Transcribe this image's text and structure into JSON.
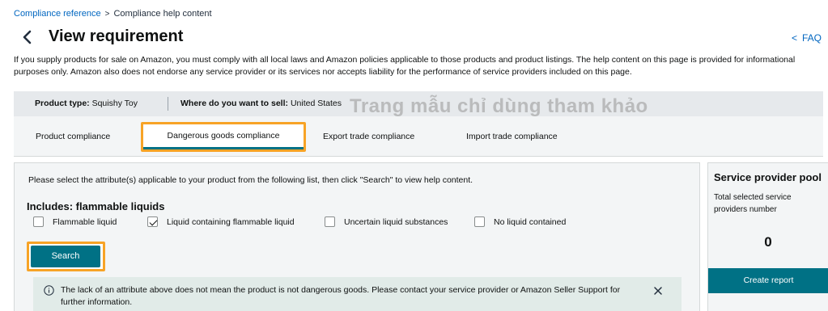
{
  "breadcrumb": {
    "root_label": "Compliance reference",
    "separator": ">",
    "current_label": "Compliance help content"
  },
  "header": {
    "title": "View requirement",
    "faq_label": "FAQ",
    "faq_chevron": "<"
  },
  "disclaimer": "If you supply products for sale on Amazon, you must comply with all local laws and Amazon policies applicable to those products and product listings. The help content on this page is provided for informational purposes only. Amazon also does not endorse any service provider or its services nor accepts liability for the performance of service providers included on this page.",
  "product_bar": {
    "product_type_label": "Product type:",
    "product_type_value": "Squishy Toy",
    "sell_where_label": "Where do you want to sell:",
    "sell_where_value": "United States"
  },
  "watermark": "Trang mẫu chỉ dùng tham khảo",
  "tabs": [
    {
      "label": "Product compliance",
      "active": false
    },
    {
      "label": "Dangerous goods compliance",
      "active": true
    },
    {
      "label": "Export trade compliance",
      "active": false
    },
    {
      "label": "Import trade compliance",
      "active": false
    }
  ],
  "main": {
    "instruction": "Please select the attribute(s) applicable to your product from the following list, then click \"Search\" to view help content.",
    "section_title": "Includes: flammable liquids",
    "checkboxes": [
      {
        "label": "Flammable liquid",
        "checked": false
      },
      {
        "label": "Liquid containing flammable liquid",
        "checked": true
      },
      {
        "label": "Uncertain liquid substances",
        "checked": false
      },
      {
        "label": "No liquid contained",
        "checked": false
      }
    ],
    "search_label": "Search",
    "alert_text": "The lack of an attribute above does not mean the product is not dangerous goods. Please contact your service provider or Amazon Seller Support for further information."
  },
  "side": {
    "title": "Service provider pool",
    "count_label": "Total selected service providers number",
    "count_value": "0",
    "create_report_label": "Create report"
  },
  "colors": {
    "accent": "#007185",
    "highlight": "#f7a326",
    "link": "#0066c0",
    "panel_bg": "#f3f5f6",
    "alert_bg": "#e1ebe8"
  }
}
